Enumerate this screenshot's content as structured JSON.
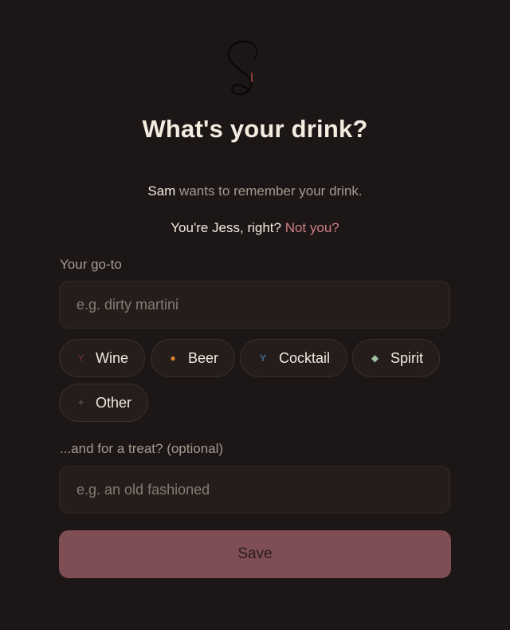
{
  "header": {
    "logo_icon": "s-logo-icon",
    "title": "What's your drink?"
  },
  "intro": {
    "requester_name": "Sam",
    "requester_text": " wants to remember your drink.",
    "identity_text": "You're Jess, right? ",
    "not_you_link": "Not you?"
  },
  "form": {
    "goto_label": "Your go-to",
    "goto_placeholder": "e.g. dirty martini",
    "goto_value": "",
    "treat_label": "...and for a treat? (optional)",
    "treat_placeholder": "e.g. an old fashioned",
    "treat_value": "",
    "chips": [
      {
        "label": "Wine",
        "icon": "wine-glass-icon",
        "glyph": "Y"
      },
      {
        "label": "Beer",
        "icon": "beer-icon",
        "glyph": "●"
      },
      {
        "label": "Cocktail",
        "icon": "cocktail-glass-icon",
        "glyph": "Y"
      },
      {
        "label": "Spirit",
        "icon": "spirit-icon",
        "glyph": "◆"
      },
      {
        "label": "Other",
        "icon": "other-drink-icon",
        "glyph": "✦"
      }
    ],
    "save_label": "Save"
  },
  "colors": {
    "background": "#1c1616",
    "accent": "#cf7f86",
    "save_button": "#7f4d54",
    "field": "#241d1b"
  }
}
